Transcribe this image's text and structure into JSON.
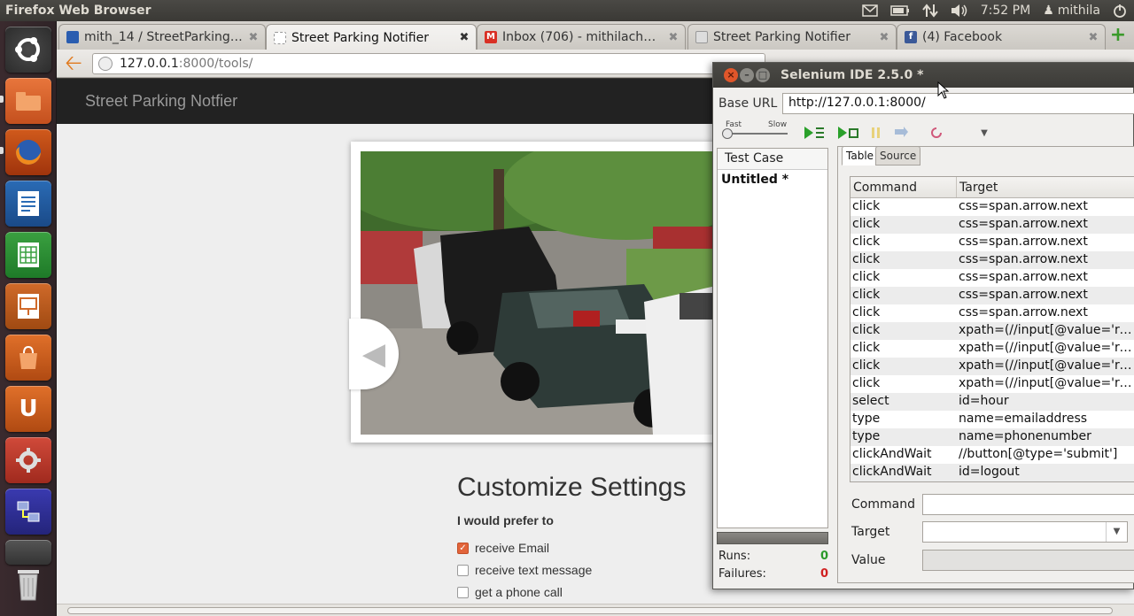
{
  "system": {
    "title": "Firefox Web Browser",
    "time": "7:52 PM",
    "user": "mithila"
  },
  "launcher": {
    "items": [
      "Dash Home",
      "Files",
      "Firefox",
      "Writer",
      "Calc",
      "Impress",
      "Software Center",
      "Ubuntu One",
      "System Settings",
      "Network",
      "Workspaces",
      "Trash"
    ]
  },
  "browser": {
    "tabs": [
      {
        "label": "mith_14 / StreetParkingN…",
        "favicon_color": "#2a5db0"
      },
      {
        "label": "Street Parking Notifier",
        "favicon_color": "#ffffff"
      },
      {
        "label": "Inbox (706) - mithilachwd…",
        "favicon_color": "#d93025"
      },
      {
        "label": "Street Parking Notifier",
        "favicon_color": "#999999"
      },
      {
        "label": "(4) Facebook",
        "favicon_color": "#3b5998"
      }
    ],
    "url_host": "127.0.0.1",
    "url_rest": ":8000/tools/",
    "new_tab_icon": "+"
  },
  "page": {
    "brand": "Street Parking Notfier",
    "settings_title": "Customize Settings",
    "prefer_label": "I would prefer to",
    "options": [
      {
        "label": "receive Email",
        "checked": true
      },
      {
        "label": "receive text message",
        "checked": false
      },
      {
        "label": "get a phone call",
        "checked": false
      }
    ]
  },
  "selenium": {
    "title": "Selenium IDE 2.5.0 *",
    "base_url_label": "Base URL",
    "base_url": "http://127.0.0.1:8000/",
    "speed_fast": "Fast",
    "speed_slow": "Slow",
    "test_case_header": "Test Case",
    "test_case_item": "Untitled *",
    "tab_table": "Table",
    "tab_source": "Source",
    "col_command": "Command",
    "col_target": "Target",
    "commands": [
      {
        "command": "click",
        "target": "css=span.arrow.next"
      },
      {
        "command": "click",
        "target": "css=span.arrow.next"
      },
      {
        "command": "click",
        "target": "css=span.arrow.next"
      },
      {
        "command": "click",
        "target": "css=span.arrow.next"
      },
      {
        "command": "click",
        "target": "css=span.arrow.next"
      },
      {
        "command": "click",
        "target": "css=span.arrow.next"
      },
      {
        "command": "click",
        "target": "css=span.arrow.next"
      },
      {
        "command": "click",
        "target": "xpath=(//input[@value='re…"
      },
      {
        "command": "click",
        "target": "xpath=(//input[@value='re…"
      },
      {
        "command": "click",
        "target": "xpath=(//input[@value='re…"
      },
      {
        "command": "click",
        "target": "xpath=(//input[@value='re…"
      },
      {
        "command": "select",
        "target": "id=hour"
      },
      {
        "command": "type",
        "target": "name=emailaddress"
      },
      {
        "command": "type",
        "target": "name=phonenumber"
      },
      {
        "command": "clickAndWait",
        "target": "//button[@type='submit']"
      },
      {
        "command": "clickAndWait",
        "target": "id=logout"
      }
    ],
    "command_label": "Command",
    "target_label": "Target",
    "value_label": "Value",
    "runs_label": "Runs:",
    "runs_value": "0",
    "failures_label": "Failures:",
    "failures_value": "0"
  }
}
